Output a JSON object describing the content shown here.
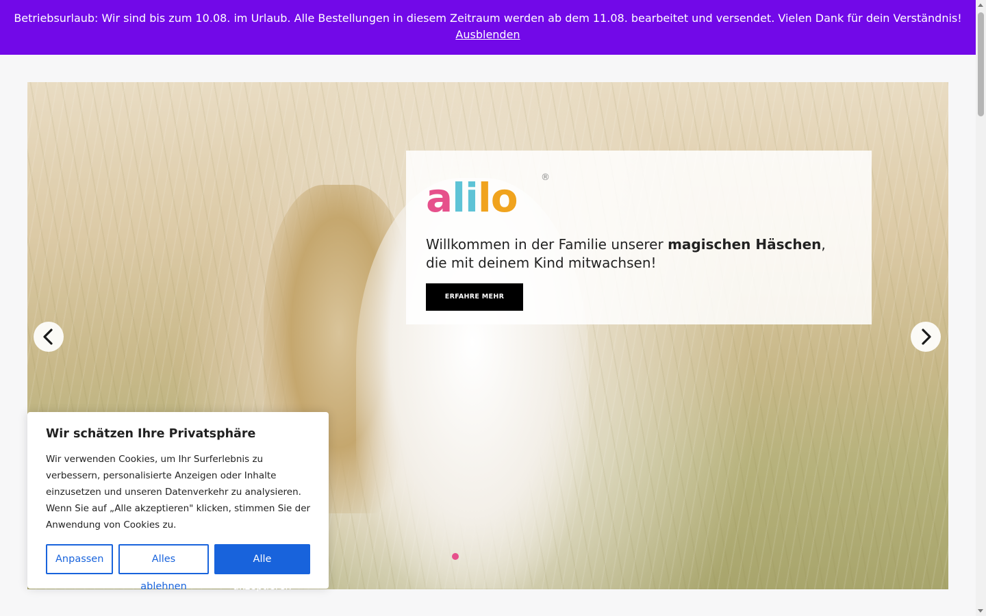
{
  "announcement": {
    "message": "Betriebsurlaub: Wir sind bis zum 10.08. im Urlaub. Alle Bestellungen in diesem Zeitraum werden ab dem 11.08. bearbeitet und versendet. Vielen Dank für dein Verständnis!",
    "hide_link": "Ausblenden",
    "background_color": "#7209e8"
  },
  "hero": {
    "logo": {
      "letters": [
        "a",
        "li",
        "lo"
      ],
      "registered_mark": "®",
      "colors": [
        "#e6508b",
        "#5ec3d6",
        "#f0a31e"
      ]
    },
    "text_before": "Willkommen in der Familie unserer ",
    "text_bold": "magischen Häschen",
    "text_after": ", die mit deinem Kind mitwachsen!",
    "cta_label": "ERFAHRE MEHR",
    "prev_icon": "chevron-left-icon",
    "next_icon": "chevron-right-icon",
    "active_slide_index": 0,
    "dot_active_color": "#e6508b"
  },
  "cookie_banner": {
    "title": "Wir schätzen Ihre Privatsphäre",
    "body": "Wir verwenden Cookies, um Ihr Surferlebnis zu verbessern, personalisierte Anzeigen oder Inhalte einzusetzen und unseren Datenverkehr zu analysieren. Wenn Sie auf „Alle akzeptieren\" klicken, stimmen Sie der Anwendung von Cookies zu.",
    "customize_label": "Anpassen",
    "reject_label": "Alles ablehnen",
    "accept_label": "Alle akzeptieren",
    "accent_color": "#1863dc"
  }
}
